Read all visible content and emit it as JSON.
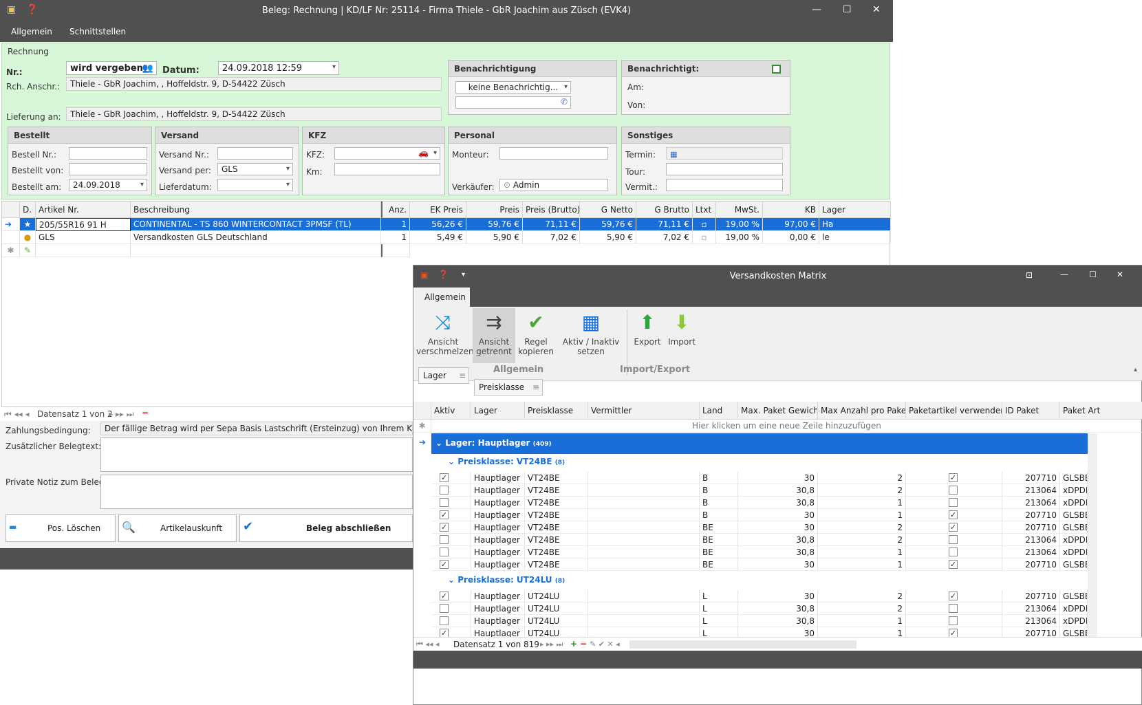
{
  "main_window": {
    "title": "Beleg: Rechnung  |  KD/LF Nr: 25114 - Firma Thiele - GbR Joachim aus Züsch (EVK4)",
    "menu": [
      "Allgemein",
      "Schnittstellen"
    ],
    "section": "Rechnung",
    "nr_label": "Nr.:",
    "nr_value": "wird vergeben",
    "datum_label": "Datum:",
    "datum_value": "24.09.2018 12:59",
    "rch_label": "Rch. Anschr.:",
    "rch_value": "Thiele - GbR Joachim, , Hoffeldstr. 9, D-54422 Züsch",
    "lief_label": "Lieferung an:",
    "lief_value": "Thiele - GbR Joachim, , Hoffeldstr. 9, D-54422 Züsch",
    "benach": {
      "title": "Benachrichtigung",
      "value": "keine Benachrichtig..."
    },
    "benachrichtigt": {
      "title": "Benachrichtigt:",
      "am": "Am:",
      "von": "Von:"
    },
    "bestellt": {
      "title": "Bestellt",
      "nr": "Bestell Nr.:",
      "von": "Bestellt von:",
      "am": "Bestellt am:",
      "am_value": "24.09.2018"
    },
    "versand": {
      "title": "Versand",
      "nr": "Versand Nr.:",
      "per": "Versand per:",
      "per_value": "GLS",
      "datum": "Lieferdatum:"
    },
    "kfz": {
      "title": "KFZ",
      "kfz": "KFZ:",
      "km": "Km:"
    },
    "personal": {
      "title": "Personal",
      "monteur": "Monteur:",
      "verkaeufer": "Verkäufer:",
      "verkaeufer_value": "Admin"
    },
    "sonstiges": {
      "title": "Sonstiges",
      "termin": "Termin:",
      "tour": "Tour:",
      "vermit": "Vermit.:"
    },
    "columns": [
      "D.",
      "Artikel Nr.",
      "Beschreibung",
      "Anz.",
      "EK Preis",
      "Preis",
      "Preis (Brutto)",
      "G Netto",
      "G Brutto",
      "Ltxt",
      "MwSt.",
      "KB",
      "Lager"
    ],
    "rows": [
      {
        "art": "205/55R16 91 H",
        "desc": "CONTINENTAL - TS 860 WINTERCONTACT 3PMSF (TL)",
        "anz": "1",
        "ek": "56,26 €",
        "preis": "59,76 €",
        "brutto": "71,11 €",
        "gnetto": "59,76 €",
        "gbrutto": "71,11 €",
        "mwst": "19,00 %",
        "kb": "97,00 €",
        "lager": "Ha"
      },
      {
        "art": "GLS",
        "desc": "Versandkosten GLS Deutschland",
        "anz": "1",
        "ek": "5,49 €",
        "preis": "5,90 €",
        "brutto": "7,02 €",
        "gnetto": "5,90 €",
        "gbrutto": "7,02 €",
        "mwst": "19,00 %",
        "kb": "0,00 €",
        "lager": "le"
      }
    ],
    "nav": "Datensatz 1 von 2",
    "zahlung_label": "Zahlungsbedingung:",
    "zahlung_value": "Der fällige Betrag wird per Sepa Basis Lastschrift (Ersteinzug) von Ihrem Konto:IB",
    "zusatz_label": "Zusätzlicher Belegtext:",
    "notiz_label": "Private Notiz zum Beleg:",
    "btn_loeschen": "Pos. Löschen",
    "btn_auskunft": "Artikelauskunft",
    "btn_abschliessen": "Beleg abschließen"
  },
  "matrix": {
    "title": "Versandkosten Matrix",
    "tab": "Allgemein",
    "buttons": [
      "Ansicht verschmelzen",
      "Ansicht getrennt",
      "Regel kopieren",
      "Aktiv / Inaktiv setzen",
      "Export",
      "Import"
    ],
    "groups": [
      "Allgemein",
      "Import/Export"
    ],
    "chips": [
      "Lager",
      "Preisklasse"
    ],
    "columns": [
      "Aktiv",
      "Lager",
      "Preisklasse",
      "Vermittler",
      "Land",
      "Max. Paket Gewicht",
      "Max Anzahl pro Paket",
      "Paketartikel verwenden",
      "ID Paket",
      "Paket Art"
    ],
    "new_row": "Hier klicken um eine neue Zeile hinzuzufügen",
    "group_lager": "Lager: Hauptlager",
    "group_lager_count": "(409)",
    "g1": "Preisklasse: VT24BE",
    "g1c": "(8)",
    "g2": "Preisklasse: UT24LU",
    "g2c": "(8)",
    "rows1": [
      {
        "a": true,
        "l": "Hauptlager",
        "p": "VT24BE",
        "la": "B",
        "g": "30",
        "n": "2",
        "v": true,
        "id": "207710",
        "art": "GLSBE"
      },
      {
        "a": false,
        "l": "Hauptlager",
        "p": "VT24BE",
        "la": "B",
        "g": "30,8",
        "n": "2",
        "v": false,
        "id": "213064",
        "art": "xDPDB"
      },
      {
        "a": false,
        "l": "Hauptlager",
        "p": "VT24BE",
        "la": "B",
        "g": "30,8",
        "n": "1",
        "v": false,
        "id": "213064",
        "art": "xDPDB"
      },
      {
        "a": true,
        "l": "Hauptlager",
        "p": "VT24BE",
        "la": "B",
        "g": "30",
        "n": "1",
        "v": true,
        "id": "207710",
        "art": "GLSBE"
      },
      {
        "a": true,
        "l": "Hauptlager",
        "p": "VT24BE",
        "la": "BE",
        "g": "30",
        "n": "2",
        "v": true,
        "id": "207710",
        "art": "GLSBE"
      },
      {
        "a": false,
        "l": "Hauptlager",
        "p": "VT24BE",
        "la": "BE",
        "g": "30,8",
        "n": "2",
        "v": false,
        "id": "213064",
        "art": "xDPDB"
      },
      {
        "a": false,
        "l": "Hauptlager",
        "p": "VT24BE",
        "la": "BE",
        "g": "30,8",
        "n": "1",
        "v": false,
        "id": "213064",
        "art": "xDPDB"
      },
      {
        "a": true,
        "l": "Hauptlager",
        "p": "VT24BE",
        "la": "BE",
        "g": "30",
        "n": "1",
        "v": true,
        "id": "207710",
        "art": "GLSBE"
      }
    ],
    "rows2": [
      {
        "a": true,
        "l": "Hauptlager",
        "p": "UT24LU",
        "la": "L",
        "g": "30",
        "n": "2",
        "v": true,
        "id": "207710",
        "art": "GLSBE"
      },
      {
        "a": false,
        "l": "Hauptlager",
        "p": "UT24LU",
        "la": "L",
        "g": "30,8",
        "n": "2",
        "v": false,
        "id": "213064",
        "art": "xDPDB"
      },
      {
        "a": false,
        "l": "Hauptlager",
        "p": "UT24LU",
        "la": "L",
        "g": "30,8",
        "n": "1",
        "v": false,
        "id": "213064",
        "art": "xDPDB"
      },
      {
        "a": true,
        "l": "Hauptlager",
        "p": "UT24LU",
        "la": "L",
        "g": "30",
        "n": "1",
        "v": true,
        "id": "207710",
        "art": "GLSBE"
      }
    ],
    "nav": "Datensatz 1 von 819"
  }
}
